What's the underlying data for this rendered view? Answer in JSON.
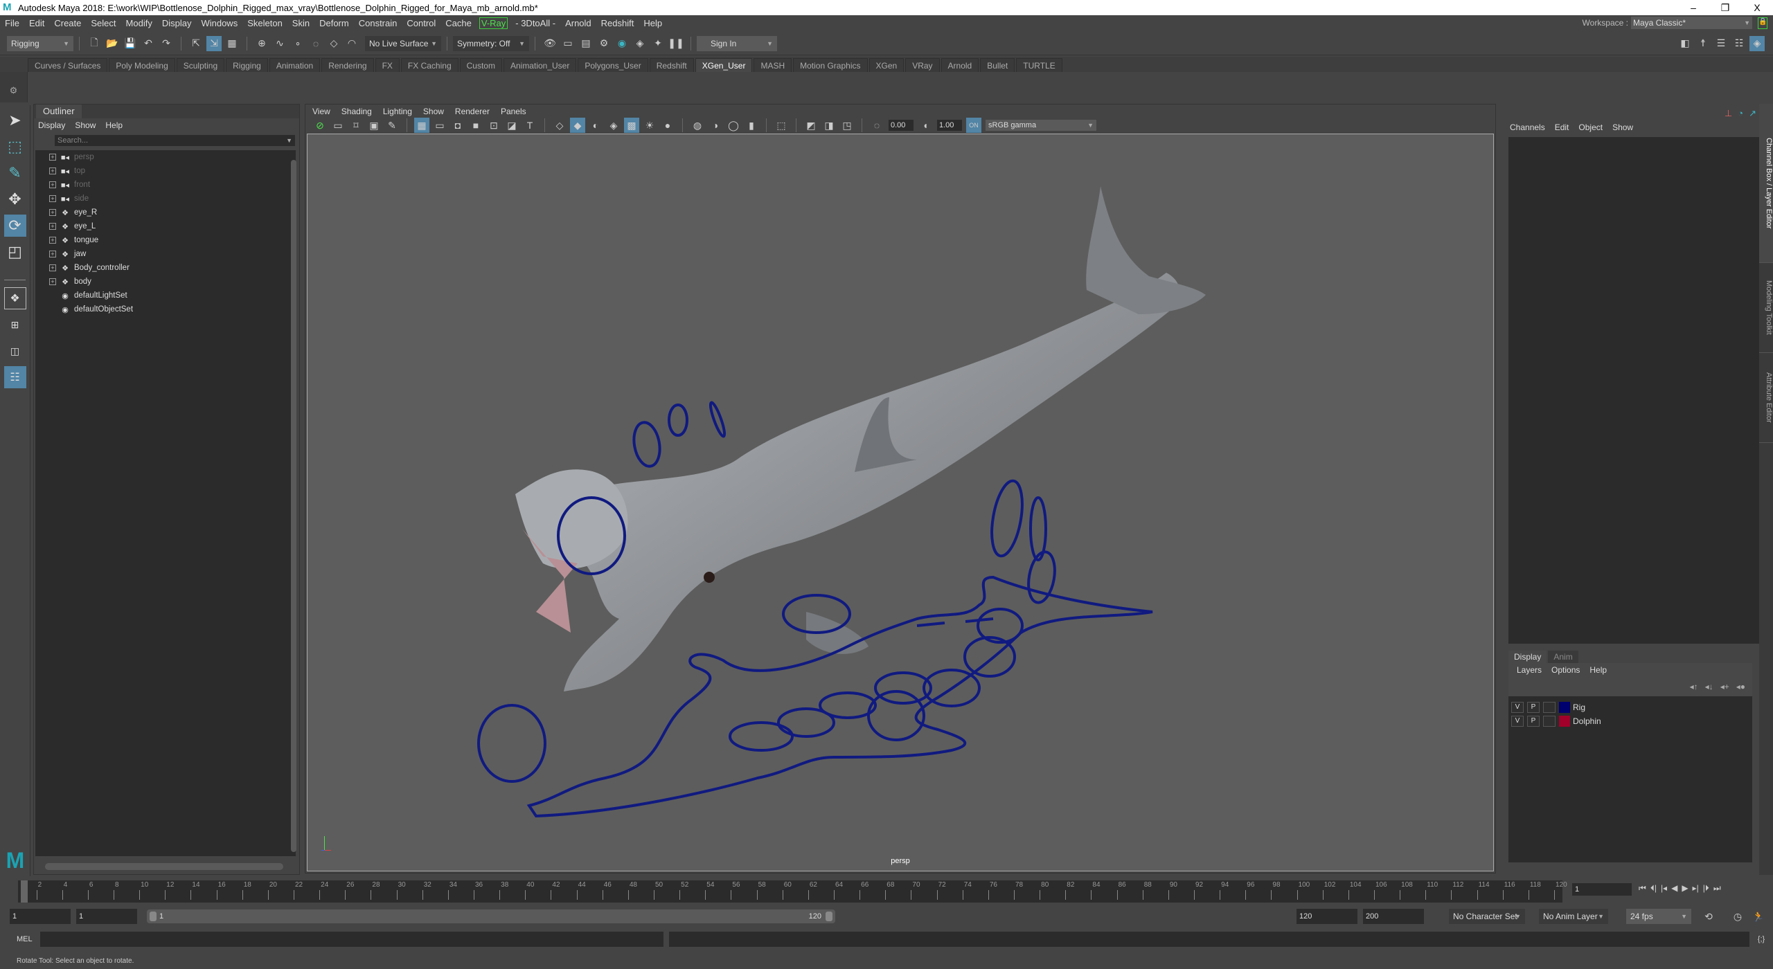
{
  "window": {
    "title": "Autodesk Maya 2018: E:\\work\\WIP\\Bottlenose_Dolphin_Rigged_max_vray\\Bottlenose_Dolphin_Rigged_for_Maya_mb_arnold.mb*",
    "minimize": "–",
    "restore": "❐",
    "close": "X"
  },
  "menubar": [
    "File",
    "Edit",
    "Create",
    "Select",
    "Modify",
    "Display",
    "Windows",
    "Skeleton",
    "Skin",
    "Deform",
    "Constrain",
    "Control",
    "Cache",
    "V-Ray",
    "- 3DtoAll -",
    "Arnold",
    "Redshift",
    "Help"
  ],
  "workspace": {
    "label": "Workspace :",
    "value": "Maya Classic*"
  },
  "statusline": {
    "mode": "Rigging",
    "live_surface": "No Live Surface",
    "symmetry": "Symmetry: Off",
    "sign_in": "Sign In"
  },
  "shelf_tabs": [
    "Curves / Surfaces",
    "Poly Modeling",
    "Sculpting",
    "Rigging",
    "Animation",
    "Rendering",
    "FX",
    "FX Caching",
    "Custom",
    "Animation_User",
    "Polygons_User",
    "Redshift",
    "XGen_User",
    "MASH",
    "Motion Graphics",
    "XGen",
    "VRay",
    "Arnold",
    "Bullet",
    "TURTLE"
  ],
  "shelf_active": "XGen_User",
  "outliner": {
    "title": "Outliner",
    "menu": [
      "Display",
      "Show",
      "Help"
    ],
    "search_placeholder": "Search...",
    "items": [
      {
        "label": "persp",
        "type": "camera"
      },
      {
        "label": "top",
        "type": "camera"
      },
      {
        "label": "front",
        "type": "camera"
      },
      {
        "label": "side",
        "type": "camera"
      },
      {
        "label": "eye_R",
        "type": "transform"
      },
      {
        "label": "eye_L",
        "type": "transform"
      },
      {
        "label": "tongue",
        "type": "transform"
      },
      {
        "label": "jaw",
        "type": "transform"
      },
      {
        "label": "Body_controller",
        "type": "transform"
      },
      {
        "label": "body",
        "type": "transform"
      },
      {
        "label": "defaultLightSet",
        "type": "set"
      },
      {
        "label": "defaultObjectSet",
        "type": "set"
      }
    ]
  },
  "viewport": {
    "menu": [
      "View",
      "Shading",
      "Lighting",
      "Show",
      "Renderer",
      "Panels"
    ],
    "exposure": "0.00",
    "gamma": "1.00",
    "color_space": "sRGB gamma",
    "camera": "persp",
    "axis": {
      "y": "y",
      "x": "x",
      "z": "z"
    }
  },
  "channelbox": {
    "menu": [
      "Channels",
      "Edit",
      "Object",
      "Show"
    ]
  },
  "side_tabs": [
    "Channel Box / Layer Editor",
    "Modeling Toolkit",
    "Attribute Editor"
  ],
  "layer_editor": {
    "tabs": [
      "Display",
      "Anim"
    ],
    "menu": [
      "Layers",
      "Options",
      "Help"
    ],
    "layers": [
      {
        "v": "V",
        "p": "P",
        "name": "Rig",
        "color": "#00006e"
      },
      {
        "v": "V",
        "p": "P",
        "name": "Dolphin",
        "color": "#a0002a"
      }
    ]
  },
  "timeslider": {
    "current_frame": "1",
    "start": 1,
    "end": 120,
    "step": 2
  },
  "range": {
    "start": "1",
    "inner_start": "1",
    "range_start": "1",
    "range_end": "120",
    "end": "120",
    "max": "200",
    "character_set": "No Character Set",
    "anim_layer": "No Anim Layer",
    "fps": "24 fps"
  },
  "cmdline": {
    "label": "MEL"
  },
  "helpline": "Rotate Tool: Select an object to rotate."
}
